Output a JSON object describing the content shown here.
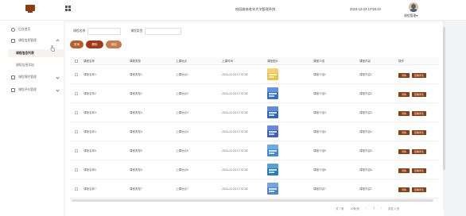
{
  "header": {
    "system_title": "校园维修老年大学管理系统",
    "datetime": "2024-12-23 17:50:34",
    "admin_name": "课程管理",
    "admin_caret": "▾"
  },
  "sidebar": {
    "items": [
      {
        "label": "后台首页"
      },
      {
        "label": "课程信息管理"
      },
      {
        "label": "课程信息列表"
      },
      {
        "label": "课程信息添加"
      },
      {
        "label": "课程预约管理"
      },
      {
        "label": "课程评价管理"
      }
    ]
  },
  "search": {
    "name_label": "课程名称",
    "type_label": "课程类型",
    "name_value": "",
    "type_value": ""
  },
  "toolbar": {
    "query_label": "查询",
    "delete_label": "删除",
    "add_label": "添加"
  },
  "table": {
    "headers": [
      "课程名称",
      "课程类型",
      "上课地点",
      "上课时间",
      "课程图片",
      "课程介绍",
      "课程内容",
      "操作"
    ],
    "rows": [
      {
        "name": "课程名称1",
        "type": "课程类型1",
        "place": "上课地点1",
        "time": "2024-12-23 17:37:29",
        "intro": "课程介绍1",
        "content": "课程内容1",
        "thumb_color": "#f0c040"
      },
      {
        "name": "课程名称2",
        "type": "课程类型2",
        "place": "上课地点2",
        "time": "2024-12-23 17:37:29",
        "intro": "课程介绍2",
        "content": "课程内容2",
        "thumb_color": "#2f6fd6"
      },
      {
        "name": "课程名称3",
        "type": "课程类型3",
        "place": "上课地点3",
        "time": "2024-12-23 17:37:29",
        "intro": "课程介绍3",
        "content": "课程内容3",
        "thumb_color": "#2a66c8"
      },
      {
        "name": "课程名称4",
        "type": "课程类型4",
        "place": "上课地点4",
        "time": "2024-12-23 17:37:29",
        "intro": "课程介绍4",
        "content": "课程内容4",
        "thumb_color": "#3a5fcf"
      },
      {
        "name": "课程名称5",
        "type": "课程类型5",
        "place": "上课地点5",
        "time": "2024-12-23 17:37:29",
        "intro": "课程介绍5",
        "content": "课程内容5",
        "thumb_color": "#3c8dd8"
      },
      {
        "name": "课程名称6",
        "type": "课程类型6",
        "place": "上课地点6",
        "time": "2024-12-23 17:37:29",
        "intro": "课程介绍6",
        "content": "课程内容6",
        "thumb_color": "#1f7fc4"
      },
      {
        "name": "课程名称7",
        "type": "课程类型7",
        "place": "上课地点7",
        "time": "2024-12-23 17:37:29",
        "intro": "课程内容7",
        "content": "课程内容7",
        "thumb_color": "#4a86d4"
      }
    ],
    "detail_label": "详情",
    "review_label": "查看评论"
  },
  "pagination": {
    "total_label": "共 7 条",
    "page_size_label": "10条/页",
    "prev_label": "‹",
    "page_label": "1",
    "next_label": "›",
    "goto_label": "前往 1 页"
  },
  "colors": {
    "accent": "#8a3e12",
    "query_button": "#b5602a",
    "delete_button": "#a33818",
    "add_button": "#c97a4c"
  }
}
